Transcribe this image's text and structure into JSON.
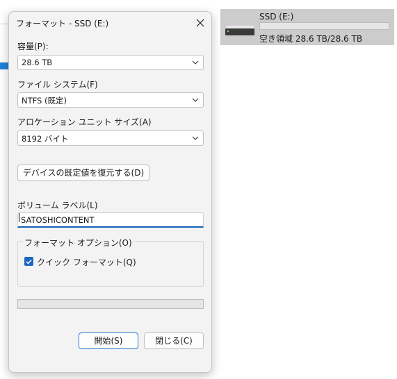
{
  "dialog": {
    "title": "フォーマット - SSD (E:)",
    "capacity": {
      "label": "容量(P):",
      "value": "28.6 TB"
    },
    "filesystem": {
      "label": "ファイル システム(F)",
      "value": "NTFS (既定)"
    },
    "allocation": {
      "label": "アロケーション ユニット サイズ(A)",
      "value": "8192 バイト"
    },
    "restore_defaults_label": "デバイスの既定値を復元する(D)",
    "volume_label": {
      "label": "ボリューム ラベル(L)",
      "value": "SATOSHICONTENT"
    },
    "options": {
      "title": "フォーマット オプション(O)",
      "quick_format_label": "クイック フォーマット(Q)",
      "quick_format_checked": true
    },
    "progress": 0,
    "start_label": "開始(S)",
    "close_label": "閉じる(C)"
  },
  "drive": {
    "name": "SSD (E:)",
    "usage": 0,
    "space_text": "空き領域 28.6 TB/28.6 TB"
  },
  "colors": {
    "accent": "#1a66c2",
    "tile_bg": "#cccccc",
    "dialog_bg": "#f3f3f3"
  }
}
